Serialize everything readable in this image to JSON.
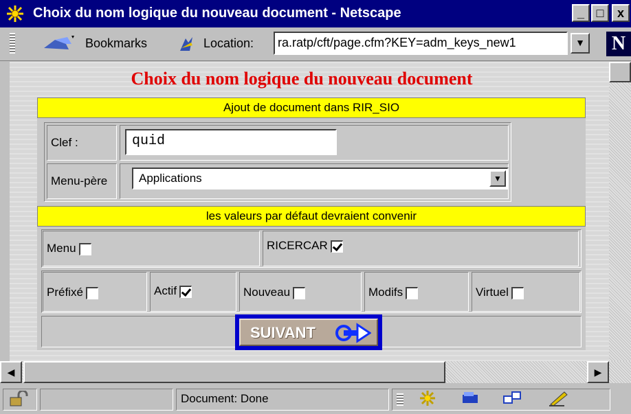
{
  "window": {
    "title": "Choix du nom logique du nouveau document - Netscape",
    "controls": {
      "minimize": "_",
      "maximize": "□",
      "close": "x"
    }
  },
  "toolbar": {
    "bookmarks_label": "Bookmarks",
    "location_label": "Location:",
    "url": "ra.ratp/cft/page.cfm?KEY=adm_keys_new1",
    "logo": "N"
  },
  "page": {
    "heading": "Choix du nom logique du nouveau document",
    "section1_title": "Ajout de document dans RIR_SIO",
    "clef_label": "Clef :",
    "clef_value": "quid",
    "menu_pere_label": "Menu-père",
    "menu_pere_value": "Applications",
    "section2_title": "les valeurs par défaut devraient convenir",
    "checkboxes_row1": [
      {
        "label": "Menu",
        "checked": false
      },
      {
        "label": "RICERCAR",
        "checked": true
      }
    ],
    "checkboxes_row2": [
      {
        "label": "Préfixé",
        "checked": false
      },
      {
        "label": "Actif",
        "checked": true
      },
      {
        "label": "Nouveau",
        "checked": false
      },
      {
        "label": "Modifs",
        "checked": false
      },
      {
        "label": "Virtuel",
        "checked": false
      }
    ],
    "submit_label": "SUIVANT"
  },
  "status": {
    "text": "Document: Done"
  },
  "icons": {
    "app": "netscape-wheel-icon",
    "bookmarks": "bookmarks-icon",
    "location": "location-icon",
    "security": "padlock-icon",
    "component_bar": [
      "netscape-wheel-icon",
      "mail-icon",
      "discussion-icon",
      "composer-icon"
    ]
  },
  "colors": {
    "title_bar": "#000080",
    "heading": "#e00000",
    "section_bar": "#ffff00",
    "button_border": "#0000cc"
  }
}
